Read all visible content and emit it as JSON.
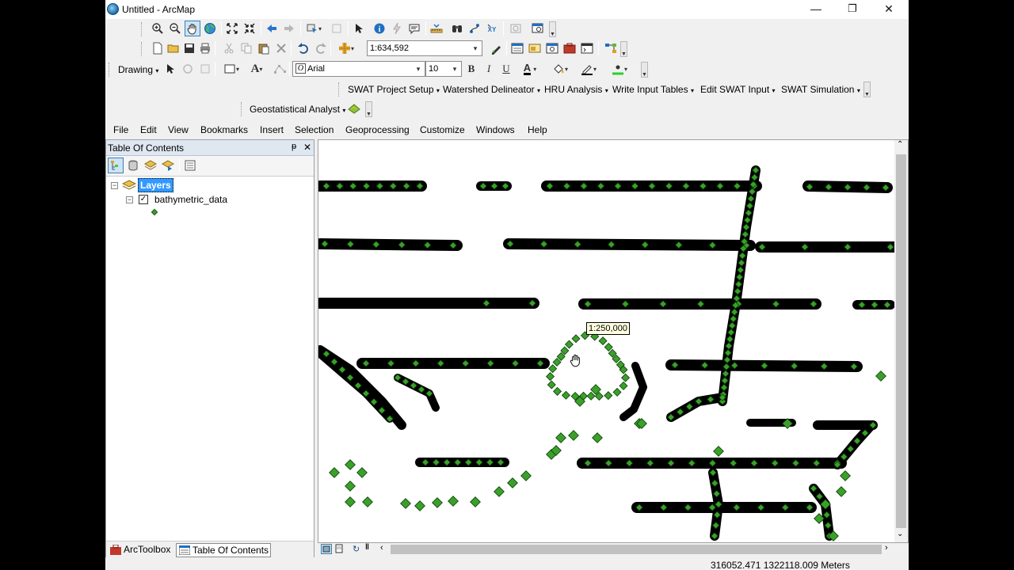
{
  "window": {
    "title": "Untitled - ArcMap",
    "controls": [
      "—",
      "❐",
      "✕"
    ]
  },
  "toolbar": {
    "map_scale": "1:634,592",
    "drawing_label": "Drawing",
    "font_name": "Arial",
    "font_size": "10",
    "bold": "B",
    "italic": "I",
    "underline": "U",
    "font_color": "A",
    "text_tool": "A"
  },
  "swat_toolbar": {
    "items": [
      "SWAT Project Setup",
      "Watershed Delineator",
      "HRU Analysis",
      "Write Input Tables",
      "Edit SWAT Input",
      "SWAT Simulation"
    ]
  },
  "geostat_toolbar": {
    "label": "Geostatistical Analyst"
  },
  "menubar": {
    "items": [
      "File",
      "Edit",
      "View",
      "Bookmarks",
      "Insert",
      "Selection",
      "Geoprocessing",
      "Customize",
      "Windows",
      "Help"
    ]
  },
  "toc": {
    "title": "Table Of Contents",
    "pin": "ᵽ",
    "close": "✕",
    "layers_label": "Layers",
    "layer_name": "bathymetric_data",
    "layer_checked": true,
    "tabs": [
      "ArcToolbox",
      "Table Of Contents"
    ]
  },
  "map": {
    "scale_tip": "1:250,000",
    "point_color": "#3aa02a"
  },
  "status": {
    "coordinates": "316052.471  1322118.009 Meters"
  }
}
